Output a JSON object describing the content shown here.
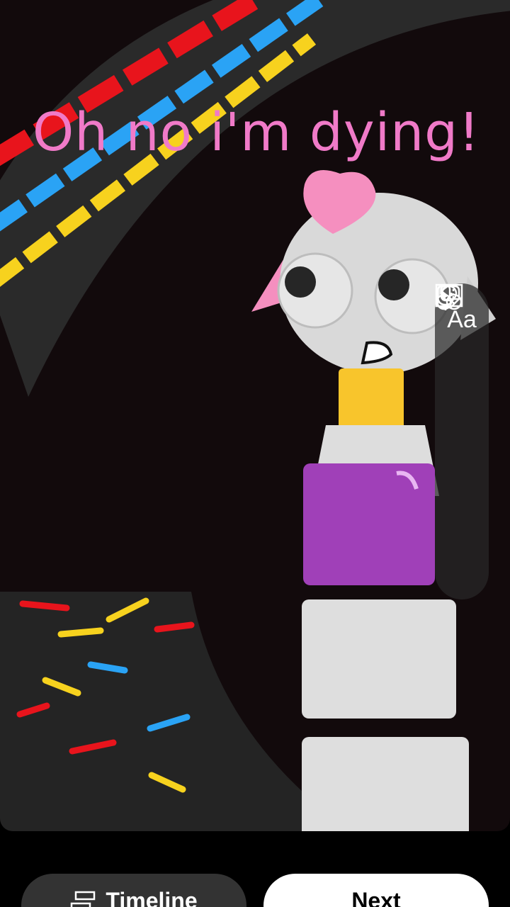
{
  "caption": {
    "text": "Oh no i'm dying!",
    "color": "#f07ac8"
  },
  "toolbar": {
    "items": [
      {
        "name": "text",
        "label": "Aa",
        "icon": "text-icon"
      },
      {
        "name": "trim",
        "label": "",
        "icon": "trim-clip-icon"
      },
      {
        "name": "filters",
        "label": "",
        "icon": "filters-icon"
      },
      {
        "name": "voiceover",
        "label": "",
        "icon": "microphone-icon"
      },
      {
        "name": "stickers",
        "label": "",
        "icon": "sticker-icon"
      }
    ]
  },
  "bottom": {
    "timeline_label": "Timeline",
    "timeline_icon": "timeline-icon",
    "next_label": "Next"
  },
  "colors": {
    "stripe_red": "#e8141c",
    "stripe_blue": "#2aa3f5",
    "stripe_yellow": "#f7d21e",
    "pink": "#f58fbf",
    "purple": "#a040b8"
  }
}
